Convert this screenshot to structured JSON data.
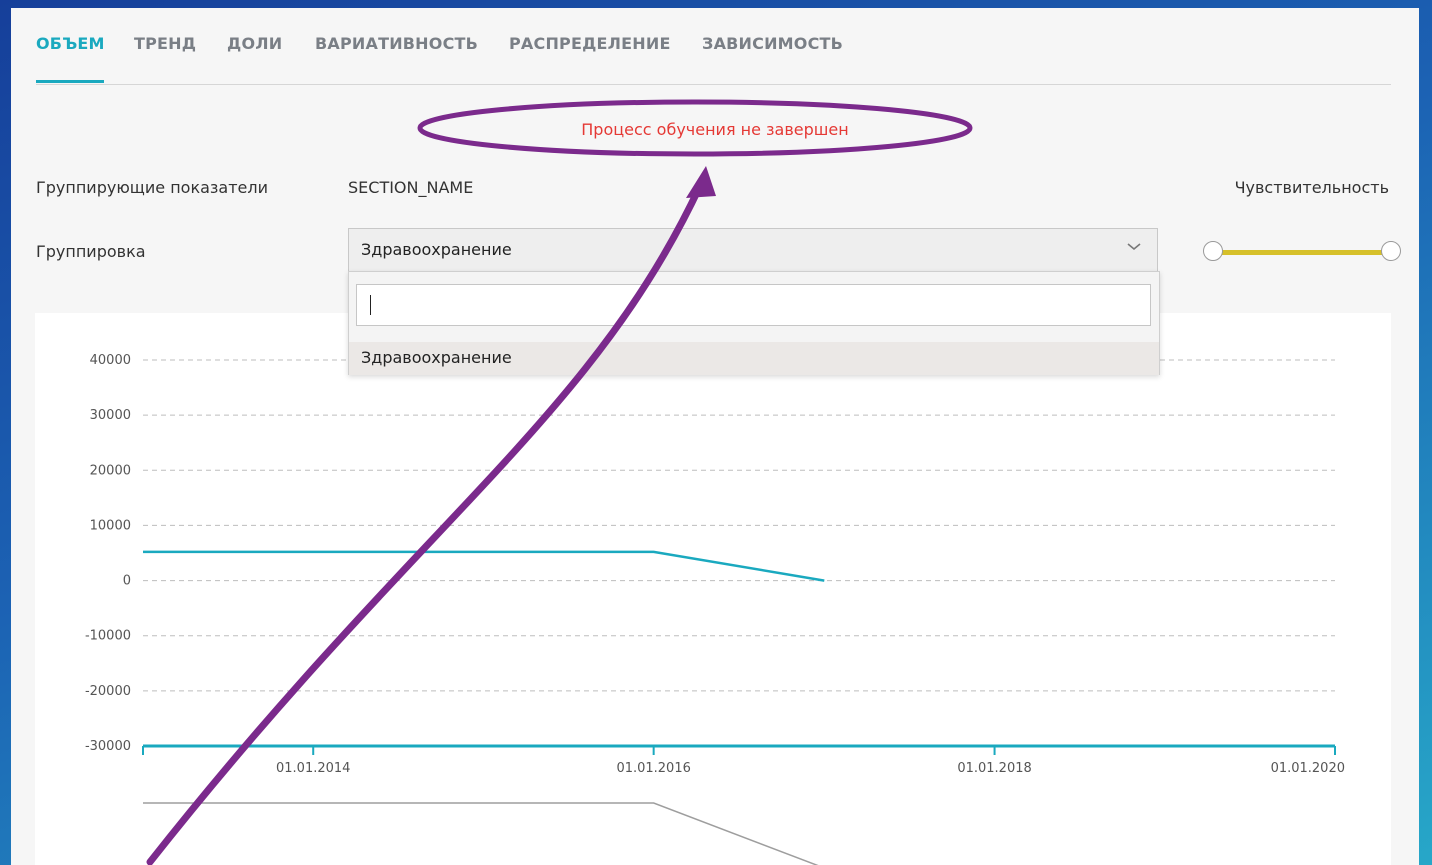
{
  "tabs": [
    {
      "label": "ОБЪЕМ",
      "active": true
    },
    {
      "label": "ТРЕНД",
      "active": false
    },
    {
      "label": "ДОЛИ",
      "active": false
    },
    {
      "label": "ВАРИАТИВНОСТЬ",
      "active": false
    },
    {
      "label": "РАСПРЕДЕЛЕНИЕ",
      "active": false
    },
    {
      "label": "ЗАВИСИМОСТЬ",
      "active": false
    }
  ],
  "status_message": "Процесс обучения не завершен",
  "grouping_indicators": {
    "label": "Группирующие показатели",
    "value": "SECTION_NAME"
  },
  "sensitivity": {
    "label": "Чувствительность",
    "range": [
      0,
      1
    ]
  },
  "grouping": {
    "label": "Группировка",
    "selected": "Здравоохранение",
    "search_value": "",
    "options": [
      "Здравоохранение"
    ]
  },
  "colors": {
    "accent": "#1aa9bf",
    "alert": "#e53935",
    "slider": "#d6c02a",
    "annotation": "#7b2a8c"
  },
  "icons": {
    "select_toggle": "chevron-down-icon"
  },
  "chart_data": {
    "type": "line",
    "y_ticks": [
      40000,
      30000,
      20000,
      10000,
      0,
      -10000,
      -20000,
      -30000
    ],
    "ylim": [
      -30000,
      40000
    ],
    "x_ticks": [
      "01.01.2014",
      "01.01.2016",
      "01.01.2018",
      "01.01.2020"
    ],
    "xlim": [
      "2013-01-01",
      "2020-01-01"
    ],
    "grid": true,
    "series": [
      {
        "x": [
          "2013-01-01",
          "2016-01-01",
          "2017-01-01"
        ],
        "y": [
          5200,
          5200,
          0
        ],
        "color": "#1aa9bf"
      }
    ],
    "overview_series": {
      "x": [
        "2013-01-01",
        "2016-01-01",
        "2017-01-01"
      ],
      "y": [
        5200,
        5200,
        0
      ],
      "color": "#9e9e9e"
    }
  }
}
